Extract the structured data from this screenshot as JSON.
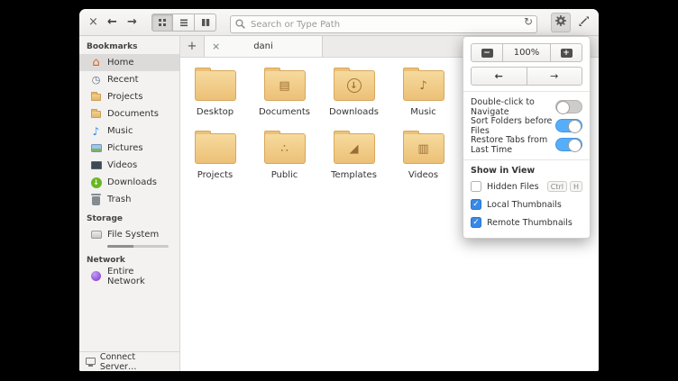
{
  "window": {
    "close": "×"
  },
  "toolbar": {
    "back": "←",
    "forward": "→",
    "search_placeholder": "Search or Type Path",
    "refresh": "↻"
  },
  "sidebar": {
    "sections": [
      {
        "title": "Bookmarks",
        "items": [
          {
            "label": "Home",
            "glyph": "⌂"
          },
          {
            "label": "Recent",
            "glyph": "◷"
          },
          {
            "label": "Projects",
            "glyph": ""
          },
          {
            "label": "Documents",
            "glyph": ""
          },
          {
            "label": "Music",
            "glyph": "♪"
          },
          {
            "label": "Pictures",
            "glyph": ""
          },
          {
            "label": "Videos",
            "glyph": ""
          },
          {
            "label": "Downloads",
            "glyph": "↓"
          },
          {
            "label": "Trash",
            "glyph": ""
          }
        ]
      },
      {
        "title": "Storage",
        "items": [
          {
            "label": "File System",
            "glyph": ""
          }
        ]
      },
      {
        "title": "Network",
        "items": [
          {
            "label": "Entire Network",
            "glyph": ""
          }
        ]
      }
    ],
    "connect_server": "Connect Server…"
  },
  "tabs": {
    "new_tab": "+",
    "close": "×",
    "active": "dani"
  },
  "files": [
    {
      "name": "Desktop",
      "emblem": ""
    },
    {
      "name": "Documents",
      "emblem": "▤"
    },
    {
      "name": "Downloads",
      "emblem": "↓"
    },
    {
      "name": "Music",
      "emblem": "♪"
    },
    {
      "name": "Projects",
      "emblem": ""
    },
    {
      "name": "Public",
      "emblem": "∴"
    },
    {
      "name": "Templates",
      "emblem": "◢"
    },
    {
      "name": "Videos",
      "emblem": "▥"
    }
  ],
  "popover": {
    "zoom_out": "−",
    "zoom_level": "100%",
    "zoom_in": "+",
    "nav_back": "←",
    "nav_forward": "→",
    "switches": [
      {
        "label": "Double-click to Navigate",
        "on": false
      },
      {
        "label": "Sort Folders before Files",
        "on": true
      },
      {
        "label": "Restore Tabs from Last Time",
        "on": true
      }
    ],
    "section_title": "Show in View",
    "checks": [
      {
        "label": "Hidden Files",
        "checked": false,
        "keys": [
          "Ctrl",
          "H"
        ]
      },
      {
        "label": "Local Thumbnails",
        "checked": true,
        "keys": []
      },
      {
        "label": "Remote Thumbnails",
        "checked": true,
        "keys": []
      }
    ],
    "check_glyph": "✓"
  },
  "colors": {
    "accent": "#3689e6",
    "switch_on": "#57aef8",
    "folder": "#ecc077",
    "selection": "#dcdbd9"
  }
}
